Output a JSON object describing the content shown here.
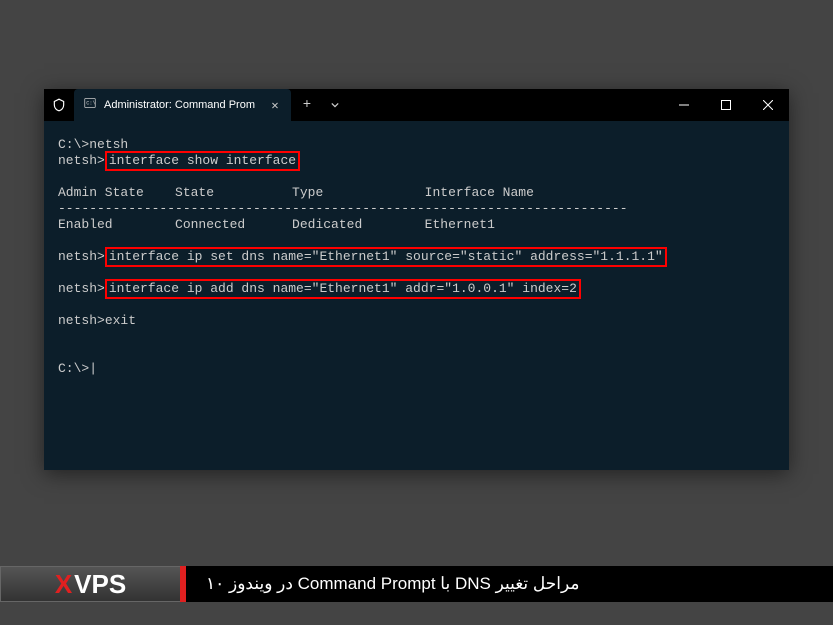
{
  "titlebar": {
    "tab_title": "Administrator: Command Prom"
  },
  "terminal": {
    "line1_prompt": "C:\\>",
    "line1_cmd": "netsh",
    "line2_prompt": "netsh>",
    "line2_cmd": "interface show interface",
    "header": "Admin State    State          Type             Interface Name",
    "separator": "-------------------------------------------------------------------------",
    "data_row": "Enabled        Connected      Dedicated        Ethernet1",
    "line_set_prompt": "netsh>",
    "line_set_cmd": "interface ip set dns name=\"Ethernet1\" source=\"static\" address=\"1.1.1.1\"",
    "line_add_prompt": "netsh>",
    "line_add_cmd": "interface ip add dns name=\"Ethernet1\" addr=\"1.0.0.1\" index=2",
    "exit_prompt": "netsh>",
    "exit_cmd": "exit",
    "final_prompt": "C:\\>",
    "cursor": "|"
  },
  "footer": {
    "logo_x": "X",
    "logo_vps": "VPS",
    "caption": "مراحل تغییر DNS با Command Prompt در ویندوز ۱۰"
  }
}
